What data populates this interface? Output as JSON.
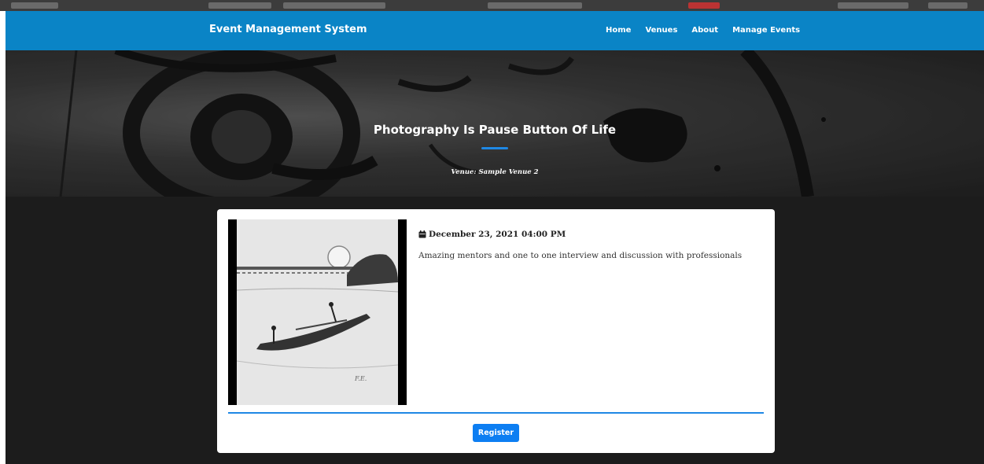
{
  "navbar": {
    "brand": "Event Management System",
    "links": [
      "Home",
      "Venues",
      "About",
      "Manage Events"
    ]
  },
  "hero": {
    "title": "Photography Is Pause Button Of Life",
    "venue": "Venue: Sample Venue 2"
  },
  "event": {
    "date_icon": "calendar-icon",
    "date": "December 23, 2021 04:00 PM",
    "description": "Amazing mentors and one to one interview and discussion with professionals",
    "image": "sketch-boat-on-river",
    "register_label": "Register"
  },
  "colors": {
    "navbar": "#0a84c6",
    "accent": "#1e88e5",
    "button": "#0d7ef2",
    "page_bg": "#1c1c1c"
  }
}
